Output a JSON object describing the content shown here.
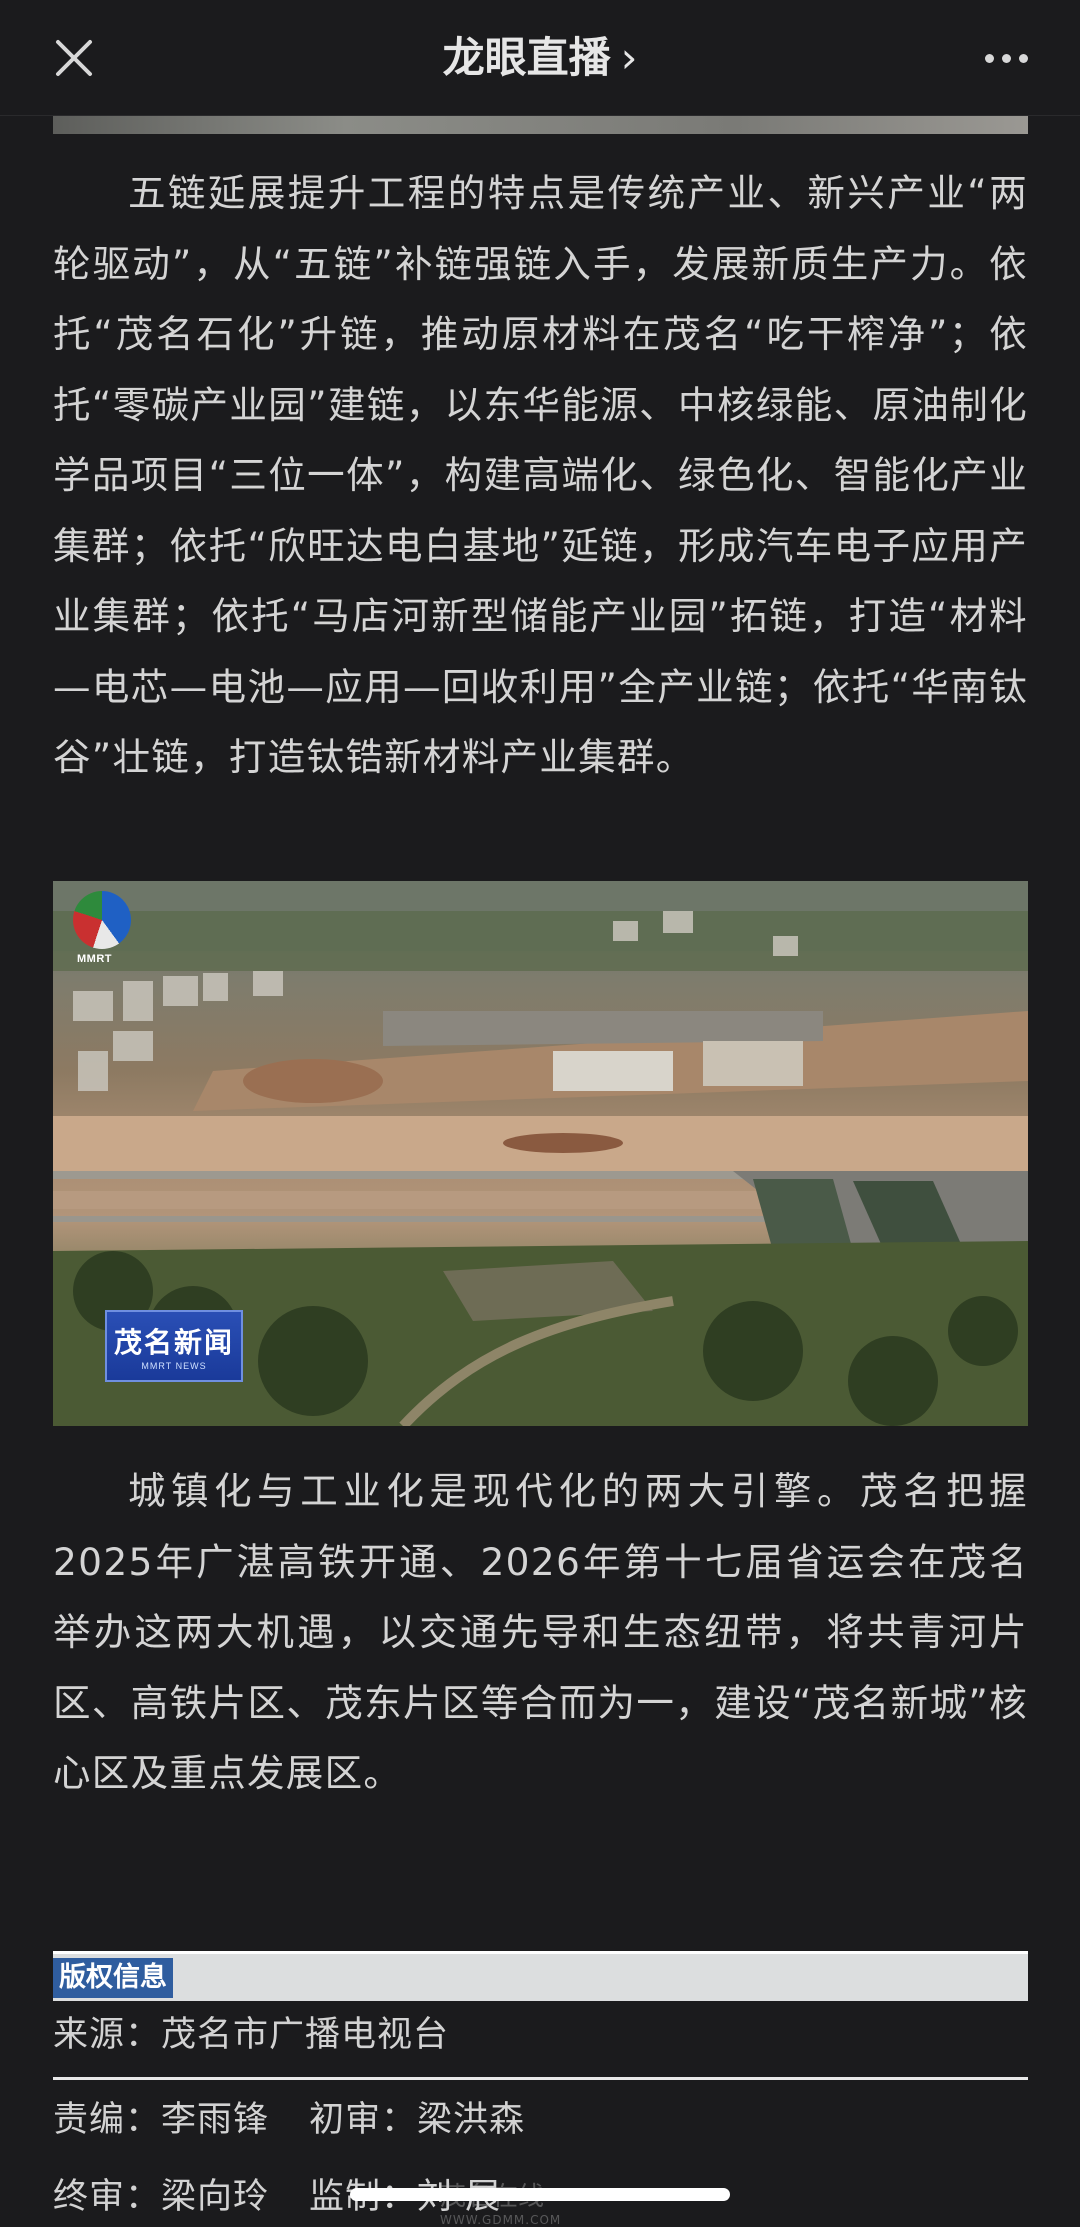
{
  "header": {
    "title": "龙眼直播",
    "close_icon": "close-icon",
    "more_icon": "more-icon"
  },
  "article": {
    "para1": "五链延展提升工程的特点是传统产业、新兴产业“两轮驱动”，从“五链”补链强链入手，发展新质生产力。依托“茂名石化”升链，推动原材料在茂名“吃干榨净”；依托“零碳产业园”建链，以东华能源、中核绿能、原油制化学品项目“三位一体”，构建高端化、绿色化、智能化产业集群；依托“欣旺达电白基地”延链，形成汽车电子应用产业集群；依托“马店河新型储能产业园”拓链，打造“材料—电芯—电池—应用—回收利用”全产业链；依托“华南钛谷”壮链，打造钛锆新材料产业集群。",
    "photo": {
      "logo_text": "MMRT",
      "badge_title": "茂名新闻",
      "badge_sub": "MMRT NEWS"
    },
    "para2": "城镇化与工业化是现代化的两大引擎。茂名把握2025年广湛高铁开通、2026年第十七届省运会在茂名举办这两大机遇，以交通先导和生态纽带，将共青河片区、高铁片区、茂东片区等合而为一，建设“茂名新城”核心区及重点发展区。"
  },
  "copyright": {
    "label": "版权信息",
    "source_label": "来源：",
    "source_value": "茂名市广播电视台",
    "editor_label": "责编：",
    "editor_value": "李雨锋",
    "first_review_label": "初审：",
    "first_review_value": "梁洪森",
    "final_review_label": "终审：",
    "final_review_value": "梁向玲",
    "supervisor_label": "监制：",
    "supervisor_value": "刘 展"
  },
  "watermark": {
    "text": "茂名在线",
    "url": "WWW.GDMM.COM"
  },
  "colors": {
    "background": "#1b1b1d",
    "copyright_label_bg": "#2f5d9f",
    "copyright_bar_bg": "#dcdedf"
  }
}
